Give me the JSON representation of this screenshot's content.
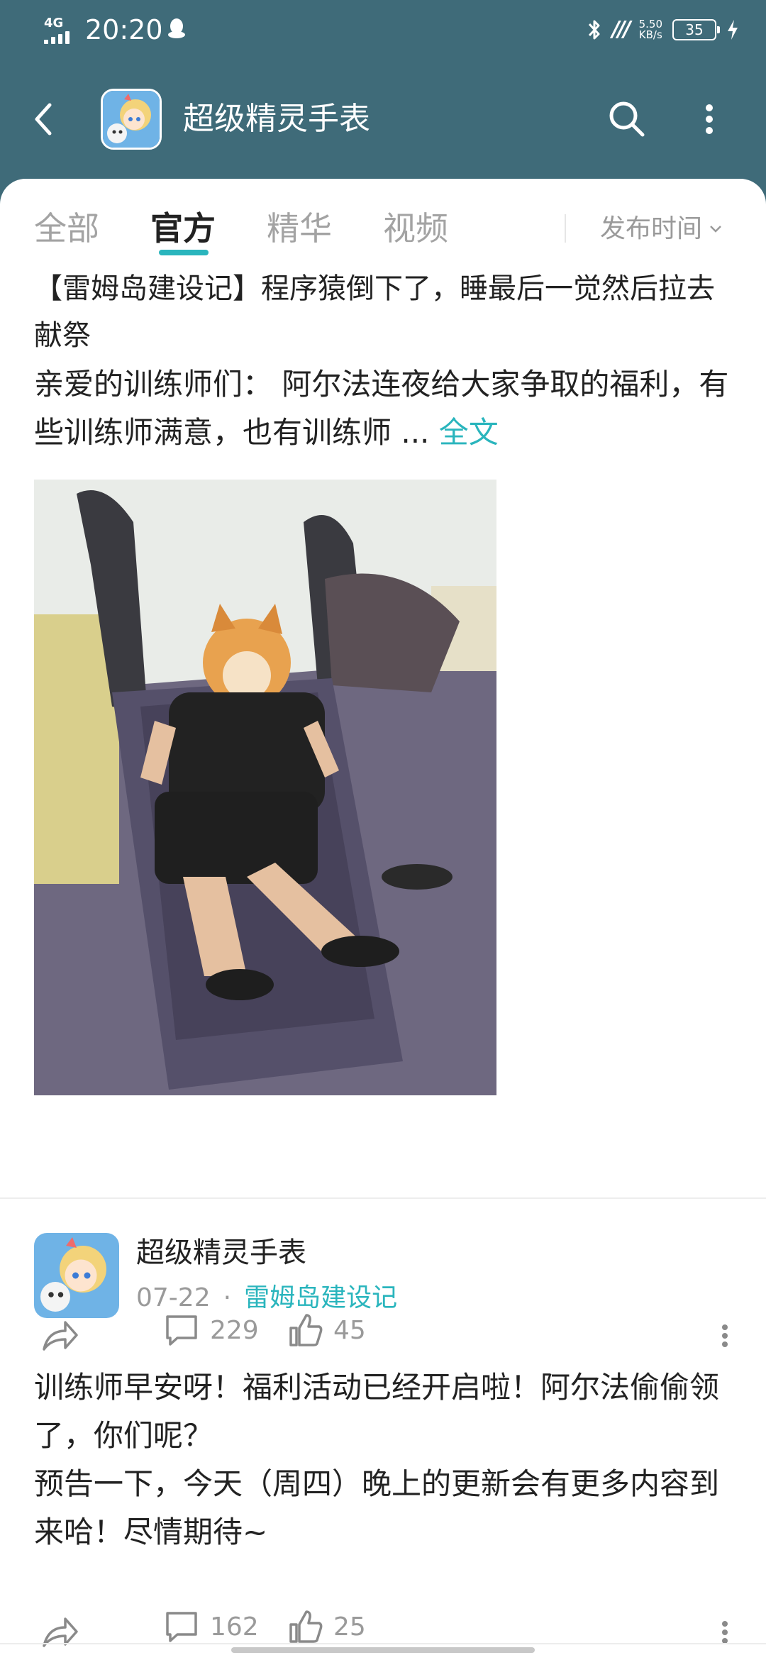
{
  "status_bar": {
    "network": "4G",
    "time": "20:20",
    "speed_value": "5.50",
    "speed_unit": "KB/s",
    "battery": "35"
  },
  "header": {
    "title": "超级精灵手表"
  },
  "tabs": [
    {
      "label": "全部",
      "active": false
    },
    {
      "label": "官方",
      "active": true
    },
    {
      "label": "精华",
      "active": false
    },
    {
      "label": "视频",
      "active": false
    }
  ],
  "sort": {
    "label": "发布时间"
  },
  "posts": [
    {
      "title": "【雷姆岛建设记】程序猿倒下了，睡最后一觉然后拉去献祭",
      "body": "亲爱的训练师们： 阿尔法连夜给大家争取的福利，有些训练师满意，也有训练师 ...",
      "full_text_link": "全文",
      "comments": "229",
      "likes": "45"
    },
    {
      "author": "超级精灵手表",
      "date": "07-22",
      "separator": "·",
      "topic": "雷姆岛建设记",
      "body_line1": "训练师早安呀！福利活动已经开启啦！阿尔法偷偷领了，你们呢？",
      "body_line2": "预告一下，今天（周四）晚上的更新会有更多内容到来哈！尽情期待~",
      "comments": "162",
      "likes": "25"
    }
  ],
  "colors": {
    "header_bg": "#3f6b79",
    "accent": "#2ab5bd",
    "muted_text": "#9a9a9a",
    "body_text": "#222222"
  },
  "icons": [
    "back-arrow-icon",
    "search-icon",
    "more-vertical-icon",
    "share-icon",
    "comment-icon",
    "like-icon",
    "chevron-down-icon",
    "bluetooth-icon",
    "charging-icon"
  ]
}
